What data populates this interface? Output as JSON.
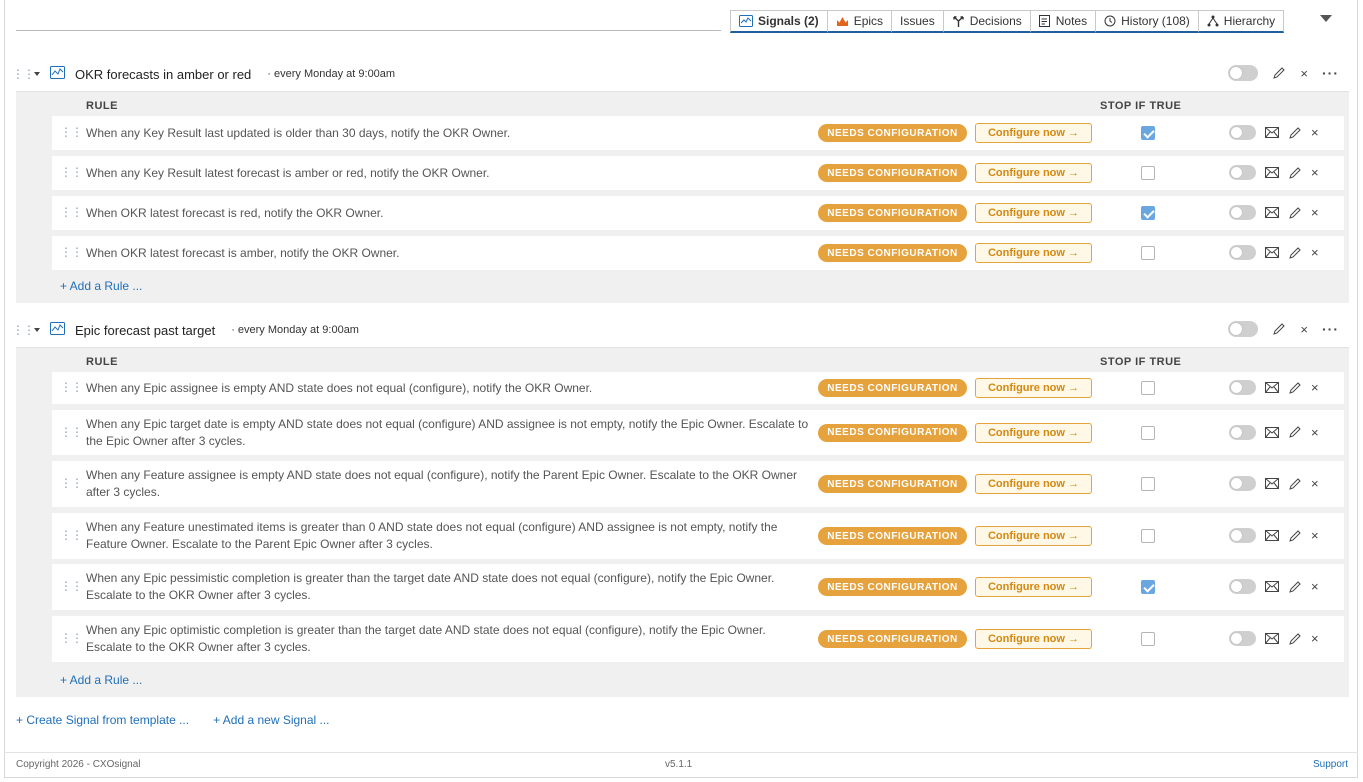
{
  "tabs": [
    {
      "label": "Signals (2)",
      "icon": "signal-icon",
      "active": true
    },
    {
      "label": "Epics",
      "icon": "crown-icon",
      "active": false
    },
    {
      "label": "Issues",
      "icon": "",
      "active": false
    },
    {
      "label": "Decisions",
      "icon": "decision-icon",
      "active": false
    },
    {
      "label": "Notes",
      "icon": "notes-icon",
      "active": false
    },
    {
      "label": "History (108)",
      "icon": "history-icon",
      "active": false
    },
    {
      "label": "Hierarchy",
      "icon": "hierarchy-icon",
      "active": false
    }
  ],
  "columns": {
    "rule": "RULE",
    "stop": "STOP IF TRUE"
  },
  "badge_label": "NEEDS CONFIGURATION",
  "configure_label": "Configure now →",
  "add_rule_label": "+ Add a Rule ...",
  "colors": {
    "accent": "#1f6fb8",
    "warning": "#e6a23c",
    "checked": "#6aa7e0"
  },
  "signals": [
    {
      "title": "OKR forecasts in amber or red",
      "schedule": "· every Monday at 9:00am",
      "rules": [
        {
          "text": "When any Key Result last updated is older than 30 days, notify the OKR Owner.",
          "stop": true
        },
        {
          "text": "When any Key Result latest forecast is amber or red, notify the OKR Owner.",
          "stop": false
        },
        {
          "text": "When OKR latest forecast is red, notify the OKR Owner.",
          "stop": true
        },
        {
          "text": "When OKR latest forecast is amber, notify the OKR Owner.",
          "stop": false
        }
      ]
    },
    {
      "title": "Epic forecast past target",
      "schedule": "· every Monday at 9:00am",
      "rules": [
        {
          "text": "When any Epic assignee is empty AND state does not equal (configure), notify the OKR Owner.",
          "stop": false
        },
        {
          "text": "When any Epic target date is empty AND state does not equal (configure) AND assignee is not empty, notify the Epic Owner. Escalate to the Epic Owner after 3 cycles.",
          "stop": false
        },
        {
          "text": "When any Feature assignee is empty AND state does not equal (configure), notify the Parent Epic Owner. Escalate to the OKR Owner after 3 cycles.",
          "stop": false
        },
        {
          "text": "When any Feature unestimated items is greater than 0 AND state does not equal (configure) AND assignee is not empty, notify the Feature Owner. Escalate to the Parent Epic Owner after 3 cycles.",
          "stop": false
        },
        {
          "text": "When any Epic pessimistic completion is greater than the target date AND state does not equal (configure), notify the Epic Owner. Escalate to the OKR Owner after 3 cycles.",
          "stop": true
        },
        {
          "text": "When any Epic optimistic completion is greater than the target date AND state does not equal (configure), notify the Epic Owner. Escalate to the OKR Owner after 3 cycles.",
          "stop": false
        }
      ]
    }
  ],
  "bottom_links": {
    "template": "+ Create Signal from template ...",
    "new_signal": "+ Add a new Signal ..."
  },
  "footer": {
    "copyright": "Copyright 2026 - CXOsignal",
    "version": "v5.1.1",
    "support": "Support"
  }
}
